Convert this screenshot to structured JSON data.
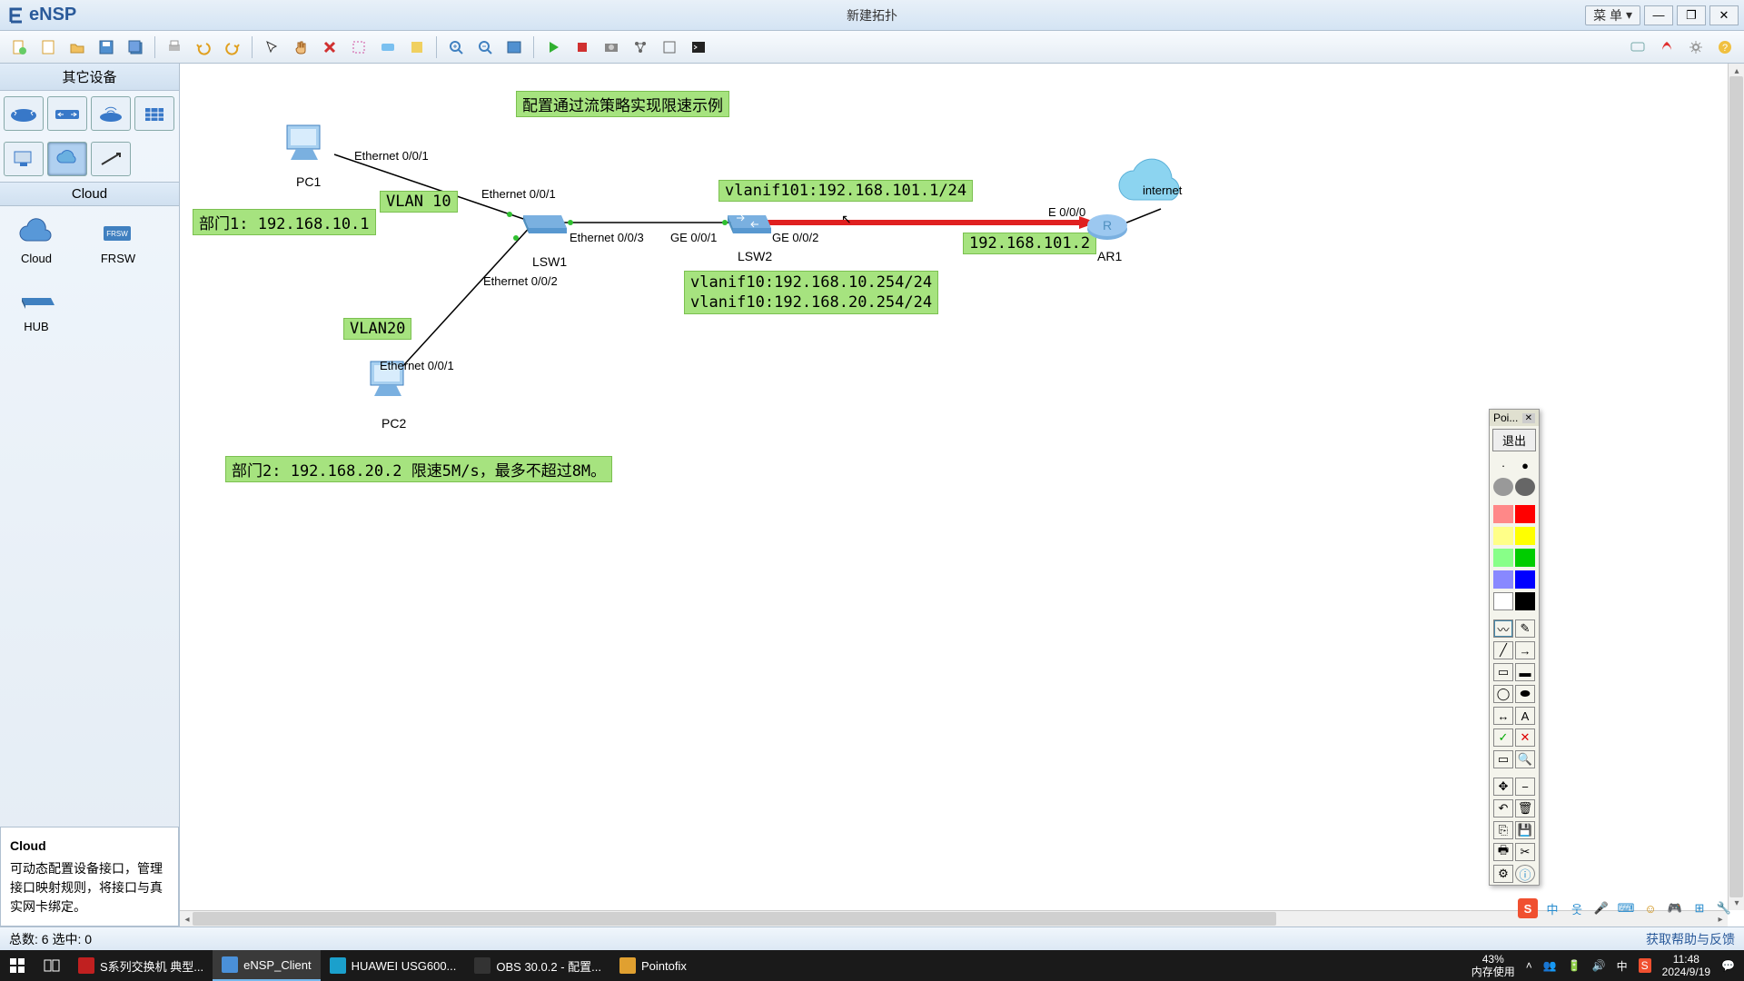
{
  "app": {
    "name": "eNSP",
    "title": "新建拓扑"
  },
  "menu": {
    "label": "菜  单"
  },
  "winbuttons": {
    "min": "—",
    "max": "❐",
    "close": "✕"
  },
  "toolbar": {
    "icons": [
      "new-file",
      "open-file",
      "open-folder",
      "save",
      "save-all",
      "print",
      "undo",
      "redo",
      "select",
      "hand",
      "delete",
      "palette",
      "text",
      "note",
      "zoom-in",
      "zoom-out",
      "fit",
      "start",
      "stop",
      "capture",
      "devices",
      "grid",
      "shell"
    ]
  },
  "toolbar_right": [
    "msg-icon",
    "huawei-icon",
    "settings-icon",
    "help-icon"
  ],
  "sidebar": {
    "head1": "其它设备",
    "row1": [
      "router",
      "switch",
      "wlan",
      "firewall"
    ],
    "row2": [
      "pc",
      "cloud",
      "osi"
    ],
    "head2": "Cloud",
    "cloud_items": [
      {
        "name": "Cloud"
      },
      {
        "name": "FRSW"
      },
      {
        "name": "HUB"
      }
    ],
    "desc_title": "Cloud",
    "desc_body": "可动态配置设备接口，管理接口映射规则，将接口与真实网卡绑定。"
  },
  "topology": {
    "title_label": "配置通过流策略实现限速示例",
    "dept1_label": "部门1: 192.168.10.1",
    "vlan10_label": "VLAN 10",
    "vlan20_label": "VLAN20",
    "vlanif101_label": "vlanif101:192.168.101.1/24",
    "vlanif10_label": "vlanif10:192.168.10.254/24\nvlanif10:192.168.20.254/24",
    "ar1_ip_label": "192.168.101.2",
    "dept2_label": "部门2: 192.168.20.2 限速5M/s，最多不超过8M。",
    "nodes": {
      "pc1": "PC1",
      "pc2": "PC2",
      "lsw1": "LSW1",
      "lsw2": "LSW2",
      "ar1": "AR1",
      "internet": "internet"
    },
    "ports": {
      "pc1_e001": "Ethernet 0/0/1",
      "lsw1_e001": "Ethernet 0/0/1",
      "lsw1_e002": "Ethernet 0/0/2",
      "lsw1_e003": "Ethernet 0/0/3",
      "lsw2_ge001": "GE 0/0/1",
      "lsw2_ge002": "GE 0/0/2",
      "pc2_e001": "Ethernet 0/0/1",
      "ar1_ge000": "E 0/0/0"
    }
  },
  "pointofix": {
    "title": "Poi...",
    "exit": "退出"
  },
  "status": {
    "left": "总数: 6 选中: 0",
    "right": "获取帮助与反馈"
  },
  "taskbar": {
    "items": [
      {
        "name": "S系列交换机 典型...",
        "icon": "#c02020"
      },
      {
        "name": "eNSP_Client",
        "icon": "#4a90d9",
        "active": true
      },
      {
        "name": "HUAWEI USG600...",
        "icon": "#1ba0cc"
      },
      {
        "name": "OBS 30.0.2 - 配置...",
        "icon": "#333"
      },
      {
        "name": "Pointofix",
        "icon": "#e0a030"
      }
    ],
    "mem_pct": "43%",
    "mem_label": "内存使用",
    "time": "11:48",
    "date": "2024/9/19"
  }
}
